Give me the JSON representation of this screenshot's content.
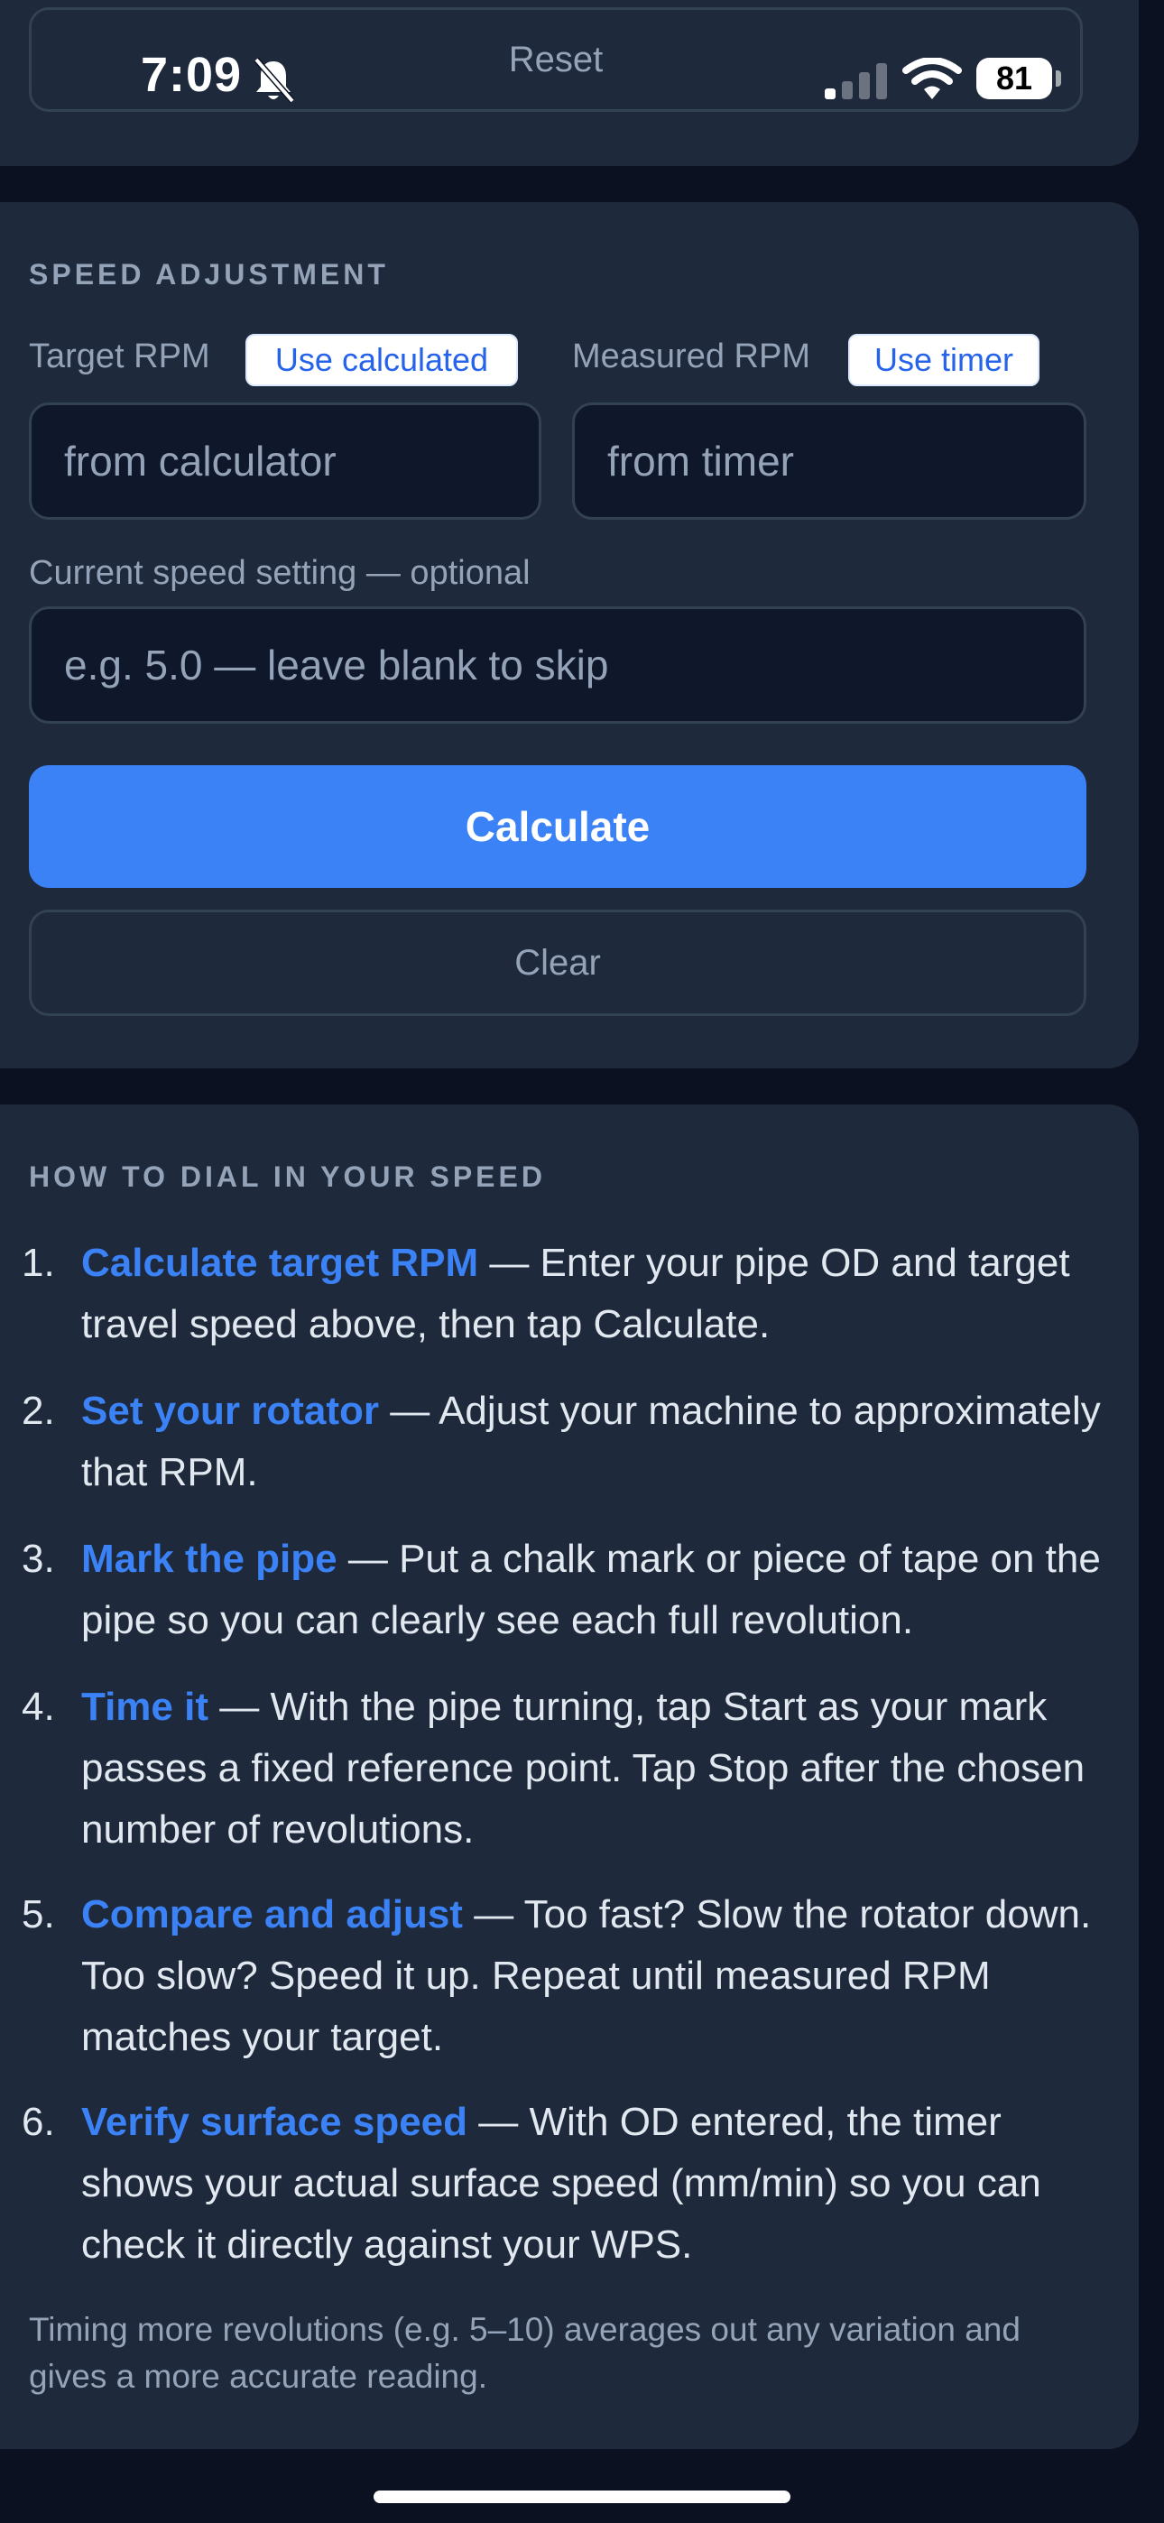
{
  "status_bar": {
    "time": "7:09",
    "battery": "81"
  },
  "top_card": {
    "reset_label": "Reset"
  },
  "speed_adjustment": {
    "heading": "SPEED ADJUSTMENT",
    "target_rpm_label": "Target RPM",
    "use_calculated_label": "Use calculated",
    "target_rpm_placeholder": "from calculator",
    "measured_rpm_label": "Measured RPM",
    "use_timer_label": "Use timer",
    "measured_rpm_placeholder": "from timer",
    "current_speed_label": "Current speed setting — optional",
    "current_speed_placeholder": "e.g. 5.0 — leave blank to skip",
    "calculate_label": "Calculate",
    "clear_label": "Clear"
  },
  "how_to": {
    "heading": "HOW TO DIAL IN YOUR SPEED",
    "steps": [
      {
        "num": "1.",
        "title": "Calculate target RPM",
        "text": " — Enter your pipe OD and target travel speed above, then tap Calculate."
      },
      {
        "num": "2.",
        "title": "Set your rotator",
        "text": " — Adjust your machine to approximately that RPM."
      },
      {
        "num": "3.",
        "title": "Mark the pipe",
        "text": " — Put a chalk mark or piece of tape on the pipe so you can clearly see each full revolution."
      },
      {
        "num": "4.",
        "title": "Time it",
        "text": " — With the pipe turning, tap Start as your mark passes a fixed reference point. Tap Stop after the chosen number of revolutions."
      },
      {
        "num": "5.",
        "title": "Compare and adjust",
        "text": " — Too fast? Slow the rotator down. Too slow? Speed it up. Repeat until measured RPM matches your target."
      },
      {
        "num": "6.",
        "title": "Verify surface speed",
        "text": " — With OD entered, the timer shows your actual surface speed (mm/min) so you can check it directly against your WPS."
      }
    ],
    "note": "Timing more revolutions (e.g. 5–10) averages out any variation and gives a more accurate reading."
  },
  "colors": {
    "accent": "#3b82f6",
    "card": "#1e293b",
    "background": "#0b1120"
  },
  "icons": [
    "bell-slash-icon",
    "signal-icon",
    "wifi-icon",
    "battery-icon"
  ]
}
